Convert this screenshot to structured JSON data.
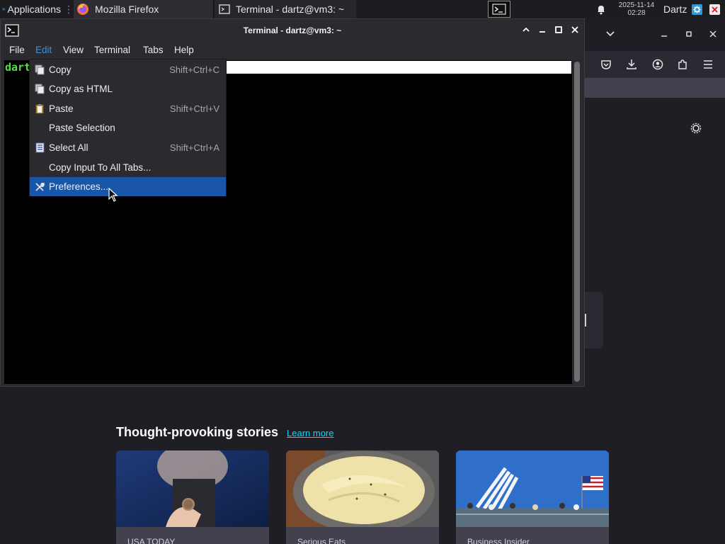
{
  "panel": {
    "apps_label": "Applications",
    "tasks": [
      {
        "label": "Mozilla Firefox",
        "icon": "firefox-icon"
      },
      {
        "label": "Terminal - dartz@vm3: ~",
        "icon": "terminal-icon"
      }
    ],
    "clock_date": "2025-11-14",
    "clock_time": "02:28",
    "user": "Dartz"
  },
  "terminal": {
    "title": "Terminal - dartz@vm3: ~",
    "menu": [
      "File",
      "Edit",
      "View",
      "Terminal",
      "Tabs",
      "Help"
    ],
    "prompt_text": "dart"
  },
  "edit_menu": {
    "items": [
      {
        "label": "Copy",
        "accel": "Shift+Ctrl+C",
        "icon": "copy-icon"
      },
      {
        "label": "Copy as HTML",
        "accel": "",
        "icon": "copy-html-icon"
      },
      {
        "label": "Paste",
        "accel": "Shift+Ctrl+V",
        "icon": "paste-icon"
      },
      {
        "label": "Paste Selection",
        "accel": "",
        "icon": ""
      },
      {
        "label": "Select All",
        "accel": "Shift+Ctrl+A",
        "icon": "select-all-icon"
      },
      {
        "label": "Copy Input To All Tabs...",
        "accel": "",
        "icon": ""
      },
      {
        "label": "Preferences...",
        "accel": "",
        "icon": "preferences-icon",
        "selected": true
      }
    ]
  },
  "firefox": {
    "stories_title": "Thought-provoking stories",
    "learn_more": "Learn more",
    "cards": [
      {
        "source": "USA TODAY"
      },
      {
        "source": "Serious Eats"
      },
      {
        "source": "Business Insider"
      }
    ]
  },
  "colors": {
    "accent": "#1a56a8",
    "prompt_green": "#55e04a",
    "link": "#00ddff"
  }
}
